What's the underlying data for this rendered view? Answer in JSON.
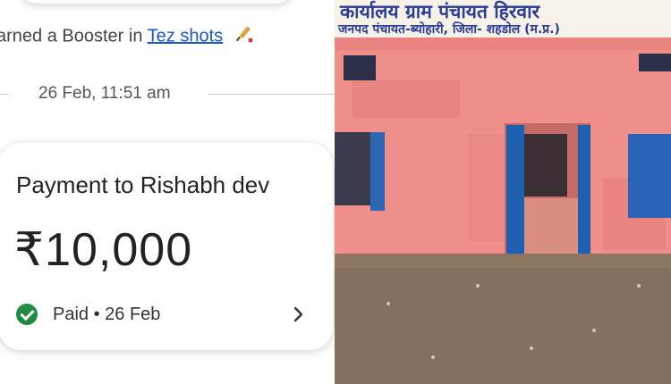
{
  "feed": {
    "booster_prefix": "arned a Booster in ",
    "booster_link": "Tez shots",
    "booster_icon": "cricket-bat-icon",
    "date_divider": "26 Feb, 11:51 am"
  },
  "payment": {
    "title": "Payment to Rishabh dev",
    "amount": "₹10,000",
    "status": "Paid • 26 Feb",
    "status_icon": "check-circle-icon",
    "status_color": "#1e8e3e",
    "chevron_icon": "chevron-right-icon"
  },
  "photo": {
    "sign_line1": "कार्यालय ग्राम पंचायत हिरवार",
    "sign_line2": "जनपद पंचायत-ब्योहारी, जिला- शहडोल (म.प्र.)",
    "wall_color": "#f08e8c",
    "door_color": "#1d5fae"
  }
}
